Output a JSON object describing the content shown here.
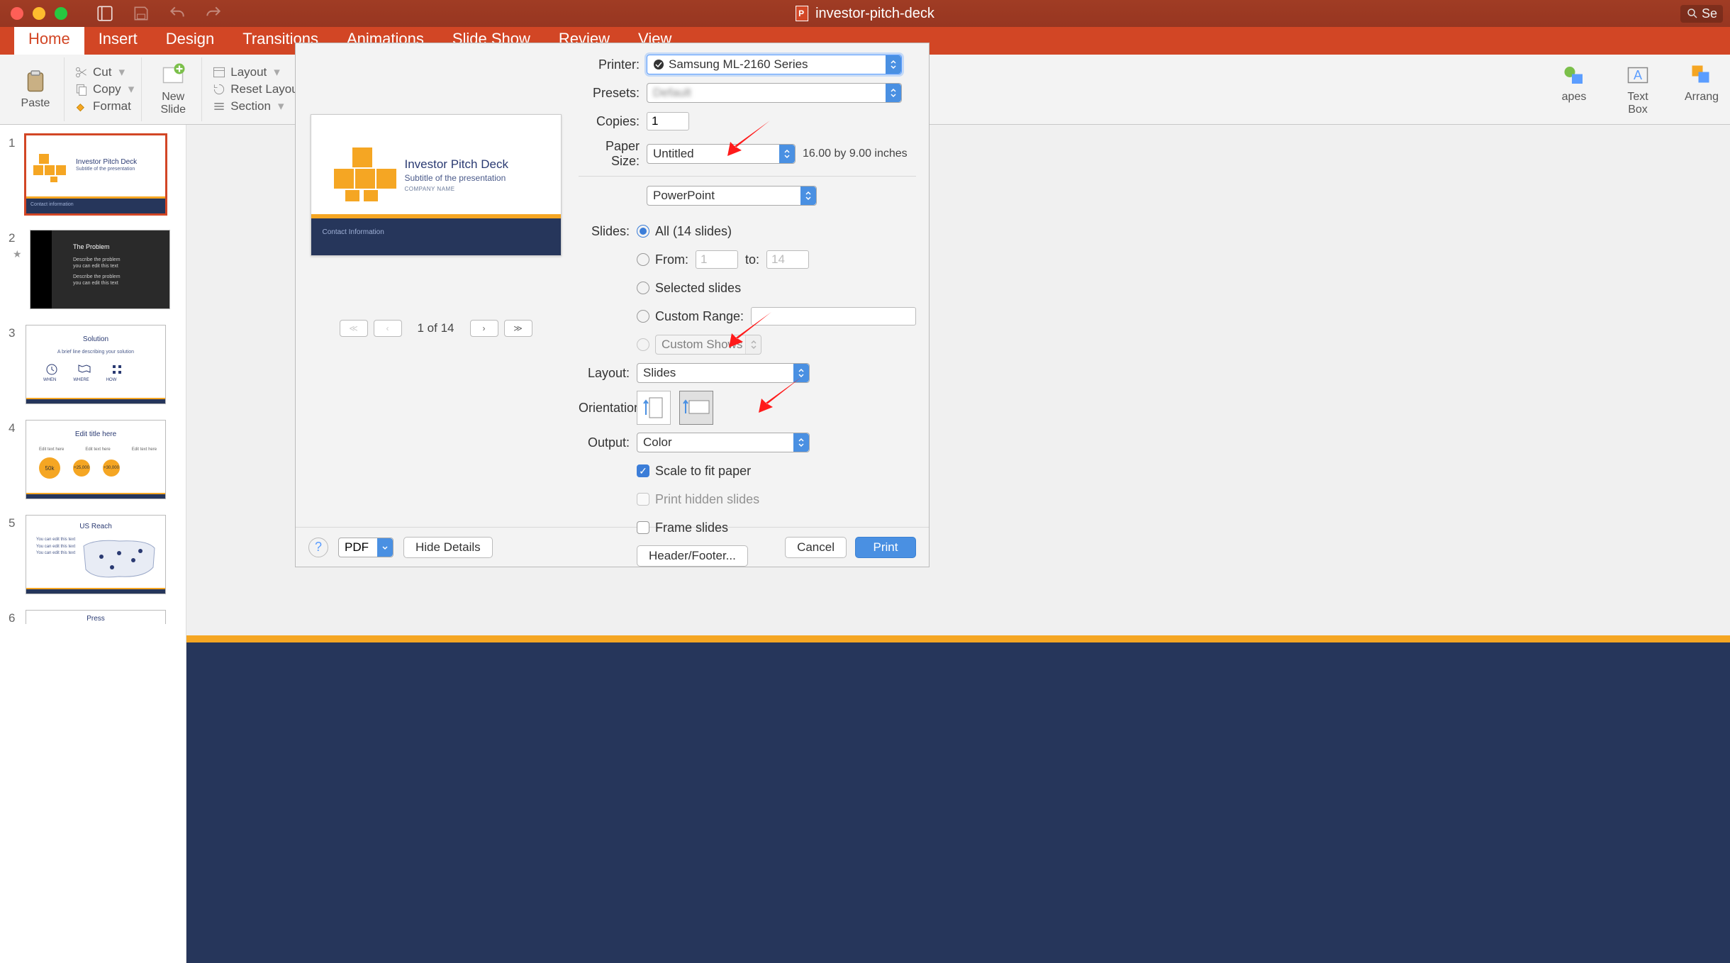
{
  "window": {
    "doc_title": "investor-pitch-deck",
    "search_placeholder": "Se"
  },
  "tabs": {
    "home": "Home",
    "insert": "Insert",
    "design": "Design",
    "transitions": "Transitions",
    "animations": "Animations",
    "slideshow": "Slide Show",
    "review": "Review",
    "view": "View"
  },
  "ribbon": {
    "paste": "Paste",
    "cut": "Cut",
    "copy": "Copy",
    "format": "Format",
    "new_slide": "New\nSlide",
    "layout": "Layout",
    "reset": "Reset Layout to Default",
    "section": "Section",
    "shapes": "apes",
    "textbox": "Text\nBox",
    "arrange": "Arrang"
  },
  "thumbnails": [
    {
      "n": "1",
      "title": "Investor Pitch Deck",
      "sub": "Subtitle of the presentation",
      "foot": "Contact information"
    },
    {
      "n": "2",
      "title": "The Problem",
      "lines": [
        "Describe the problem",
        "you can edit this text",
        "Describe the problem",
        "you can edit this text"
      ]
    },
    {
      "n": "3",
      "title": "Solution",
      "sub": "A brief line describing your solution",
      "labels": [
        "WHEN",
        "WHERE",
        "HOW"
      ]
    },
    {
      "n": "4",
      "title": "Edit title here",
      "labels": [
        "Edit text here",
        "Edit text here",
        "Edit text here"
      ],
      "vals": [
        "50k",
        "+25,000",
        "+30,000"
      ]
    },
    {
      "n": "5",
      "title": "US Reach",
      "labels": [
        "You can edit this text",
        "You can edit this text",
        "You can edit this text"
      ]
    },
    {
      "n": "6",
      "title": "Press"
    }
  ],
  "preview_slide": {
    "title": "Investor Pitch Deck",
    "subtitle": "Subtitle of the presentation",
    "company": "COMPANY NAME",
    "footer": "Contact Information"
  },
  "preview_nav": {
    "label": "1 of 14"
  },
  "print": {
    "labels": {
      "printer": "Printer:",
      "presets": "Presets:",
      "copies": "Copies:",
      "paper": "Paper Size:",
      "slides": "Slides:",
      "from": "From:",
      "to": "to:",
      "layout": "Layout:",
      "orientation": "Orientation:",
      "output": "Output:"
    },
    "printer_value": "Samsung ML-2160 Series",
    "presets_value": "Default",
    "copies_value": "1",
    "paper_value": "Untitled",
    "paper_dims": "16.00 by 9.00 inches",
    "app_dropdown": "PowerPoint",
    "slides_all": "All  (14 slides)",
    "from_value": "1",
    "to_value": "14",
    "selected_slides": "Selected slides",
    "custom_range": "Custom Range:",
    "custom_shows": "Custom Shows",
    "layout_value": "Slides",
    "output_value": "Color",
    "scale": "Scale to fit paper",
    "hidden": "Print hidden slides",
    "frame": "Frame slides",
    "header_footer": "Header/Footer...",
    "pdf": "PDF",
    "hide_details": "Hide Details",
    "cancel": "Cancel",
    "print_btn": "Print"
  }
}
